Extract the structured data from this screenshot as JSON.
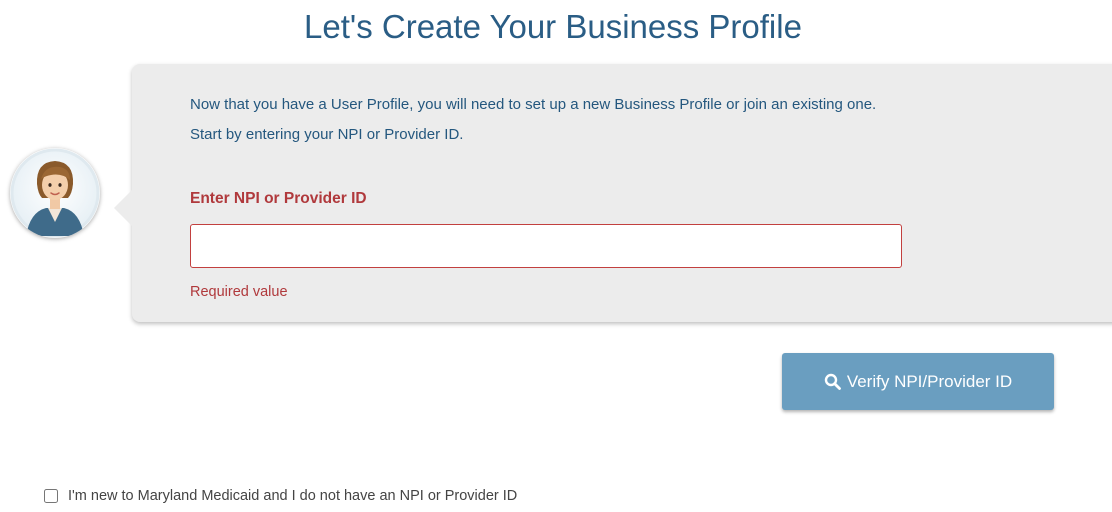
{
  "page": {
    "title": "Let's Create Your Business Profile"
  },
  "avatar": {
    "icon": "assistant-avatar-icon"
  },
  "card": {
    "intro_line1": "Now that you have a User Profile, you will need to set up a new Business Profile or join an existing one.",
    "intro_line2": "Start by entering your NPI or Provider ID.",
    "field_label": "Enter NPI or Provider ID",
    "field_value": "",
    "field_placeholder": "",
    "error_text": "Required value"
  },
  "verify": {
    "label": "Verify NPI/Provider ID",
    "icon": "search-icon"
  },
  "new_provider": {
    "label": "I'm new to Maryland Medicaid and I do not have an NPI or Provider ID",
    "checked": false
  },
  "colors": {
    "title": "#2a5d85",
    "intro_text": "#24577e",
    "error": "#b0393c",
    "button_bg": "#6a9ec0",
    "card_bg": "#ececec"
  }
}
